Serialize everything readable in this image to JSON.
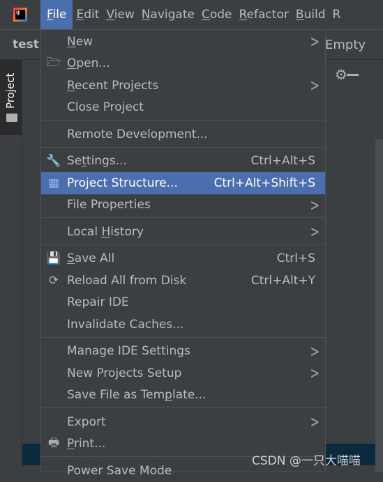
{
  "menubar": {
    "items": [
      {
        "label": "File",
        "mn": 0,
        "active": true
      },
      {
        "label": "Edit",
        "mn": 0
      },
      {
        "label": "View",
        "mn": 0
      },
      {
        "label": "Navigate",
        "mn": 0
      },
      {
        "label": "Code",
        "mn": 0
      },
      {
        "label": "Refactor",
        "mn": 0
      },
      {
        "label": "Build",
        "mn": 0
      },
      {
        "label": "R",
        "mn": -1
      }
    ]
  },
  "toolbar": {
    "project": "test",
    "right_text": "Empty"
  },
  "side": {
    "project_tab": "Project"
  },
  "menu": {
    "items": [
      {
        "label": "New",
        "mn": 0,
        "sub": true
      },
      {
        "label": "Open...",
        "mn": 0,
        "icon": "folder-open-icon"
      },
      {
        "label": "Recent Projects",
        "mn": 0,
        "sub": true
      },
      {
        "label": "Close Project",
        "mn": -1
      },
      {
        "sep": true
      },
      {
        "label": "Remote Development...",
        "mn": -1
      },
      {
        "sep": true
      },
      {
        "label": "Settings...",
        "mn": 2,
        "icon": "wrench-icon",
        "shortcut": "Ctrl+Alt+S"
      },
      {
        "label": "Project Structure...",
        "mn": -1,
        "icon": "project-structure-icon",
        "shortcut": "Ctrl+Alt+Shift+S",
        "selected": true
      },
      {
        "label": "File Properties",
        "mn": -1,
        "sub": true
      },
      {
        "sep": true
      },
      {
        "label": "Local History",
        "mn": 6,
        "sub": true
      },
      {
        "sep": true
      },
      {
        "label": "Save All",
        "mn": 0,
        "icon": "save-icon",
        "shortcut": "Ctrl+S"
      },
      {
        "label": "Reload All from Disk",
        "mn": -1,
        "icon": "reload-icon",
        "shortcut": "Ctrl+Alt+Y"
      },
      {
        "label": "Repair IDE",
        "mn": -1
      },
      {
        "label": "Invalidate Caches...",
        "mn": -1
      },
      {
        "sep": true
      },
      {
        "label": "Manage IDE Settings",
        "mn": -1,
        "sub": true
      },
      {
        "label": "New Projects Setup",
        "mn": -1,
        "sub": true
      },
      {
        "label": "Save File as Template...",
        "mn": 16
      },
      {
        "sep": true
      },
      {
        "label": "Export",
        "mn": -1,
        "sub": true
      },
      {
        "label": "Print...",
        "mn": 0,
        "icon": "print-icon"
      },
      {
        "sep": true
      },
      {
        "label": "Power Save Mode",
        "mn": -1
      }
    ]
  },
  "watermark": "CSDN @一只大喵喵",
  "colors": {
    "accent": "#4b6eaf",
    "background": "#3c3f41"
  }
}
